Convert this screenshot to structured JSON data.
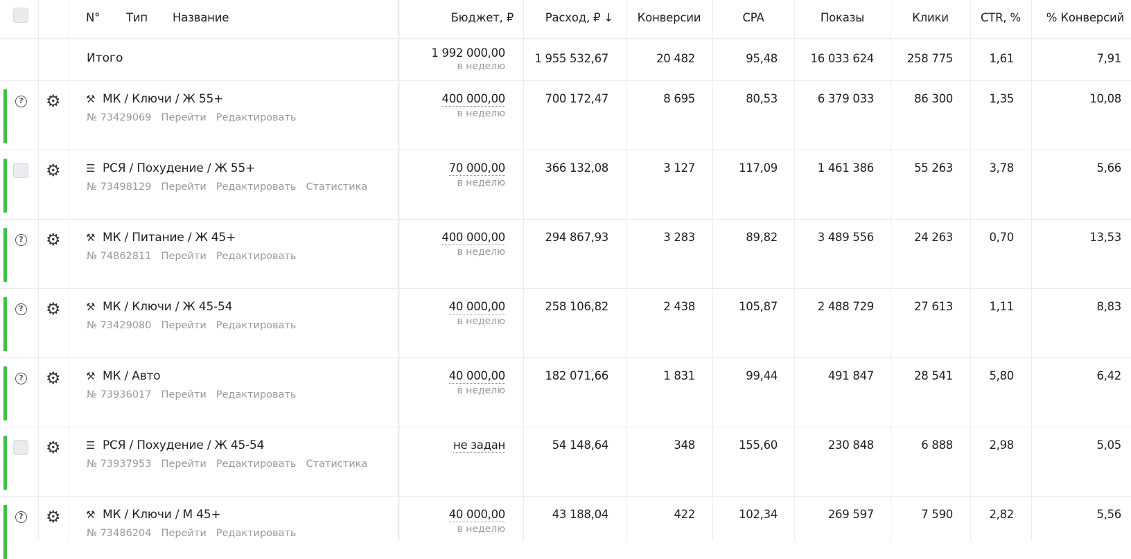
{
  "header": {
    "no": "N°",
    "type": "Тип",
    "name": "Название",
    "budget": "Бюджет, ₽",
    "spend": "Расход, ₽ ↓",
    "conversions": "Конверсии",
    "cpa": "CPA",
    "impressions": "Показы",
    "clicks": "Клики",
    "ctr": "CTR, %",
    "conv_rate": "% Конверсий"
  },
  "totals": {
    "label": "Итого",
    "budget": "1 992 000,00",
    "budget_period": "в неделю",
    "spend": "1 955 532,67",
    "conversions": "20 482",
    "cpa": "95,48",
    "impressions": "16 033 624",
    "clicks": "258 775",
    "ctr": "1,61",
    "conv_rate": "7,91"
  },
  "links": {
    "go": "Перейти",
    "edit": "Редактировать",
    "stats": "Статистика"
  },
  "rows": [
    {
      "status": "help",
      "type": "master",
      "name": "МК / Ключи / Ж 55+",
      "id": "№ 73429069",
      "budget": "400 000,00",
      "budget_period": "в неделю",
      "spend": "700 172,47",
      "conversions": "8 695",
      "cpa": "80,53",
      "impressions": "6 379 033",
      "clicks": "86 300",
      "ctr": "1,35",
      "conv_rate": "10,08"
    },
    {
      "status": "checkbox",
      "type": "rsya",
      "name": "РСЯ / Похудение / Ж 55+",
      "id": "№ 73498129",
      "budget": "70 000,00",
      "budget_period": "в неделю",
      "spend": "366 132,08",
      "conversions": "3 127",
      "cpa": "117,09",
      "impressions": "1 461 386",
      "clicks": "55 263",
      "ctr": "3,78",
      "conv_rate": "5,66"
    },
    {
      "status": "help",
      "type": "master",
      "name": "МК / Питание / Ж 45+",
      "id": "№ 74862811",
      "budget": "400 000,00",
      "budget_period": "в неделю",
      "spend": "294 867,93",
      "conversions": "3 283",
      "cpa": "89,82",
      "impressions": "3 489 556",
      "clicks": "24 263",
      "ctr": "0,70",
      "conv_rate": "13,53"
    },
    {
      "status": "help",
      "type": "master",
      "name": "МК / Ключи / Ж 45-54",
      "id": "№ 73429080",
      "budget": "40 000,00",
      "budget_period": "в неделю",
      "spend": "258 106,82",
      "conversions": "2 438",
      "cpa": "105,87",
      "impressions": "2 488 729",
      "clicks": "27 613",
      "ctr": "1,11",
      "conv_rate": "8,83"
    },
    {
      "status": "help",
      "type": "master",
      "name": "МК / Авто",
      "id": "№ 73936017",
      "budget": "40 000,00",
      "budget_period": "в неделю",
      "spend": "182 071,66",
      "conversions": "1 831",
      "cpa": "99,44",
      "impressions": "491 847",
      "clicks": "28 541",
      "ctr": "5,80",
      "conv_rate": "6,42"
    },
    {
      "status": "checkbox",
      "type": "rsya",
      "name": "РСЯ / Похудение / Ж 45-54",
      "id": "№ 73937953",
      "budget": "не задан",
      "budget_period": "",
      "spend": "54 148,64",
      "conversions": "348",
      "cpa": "155,60",
      "impressions": "230 848",
      "clicks": "6 888",
      "ctr": "2,98",
      "conv_rate": "5,05"
    },
    {
      "status": "help",
      "type": "master",
      "name": "МК / Ключи / М 45+",
      "id": "№ 73486204",
      "budget": "40 000,00",
      "budget_period": "в неделю",
      "spend": "43 188,04",
      "conversions": "422",
      "cpa": "102,34",
      "impressions": "269 597",
      "clicks": "7 590",
      "ctr": "2,82",
      "conv_rate": "5,56"
    }
  ],
  "icons": {
    "master": "wand-icon",
    "rsya": "network-icon",
    "settings": "gear-icon",
    "help": "help-icon"
  },
  "colors": {
    "active_bar": "#3cc046",
    "muted": "#9a9a9a"
  }
}
